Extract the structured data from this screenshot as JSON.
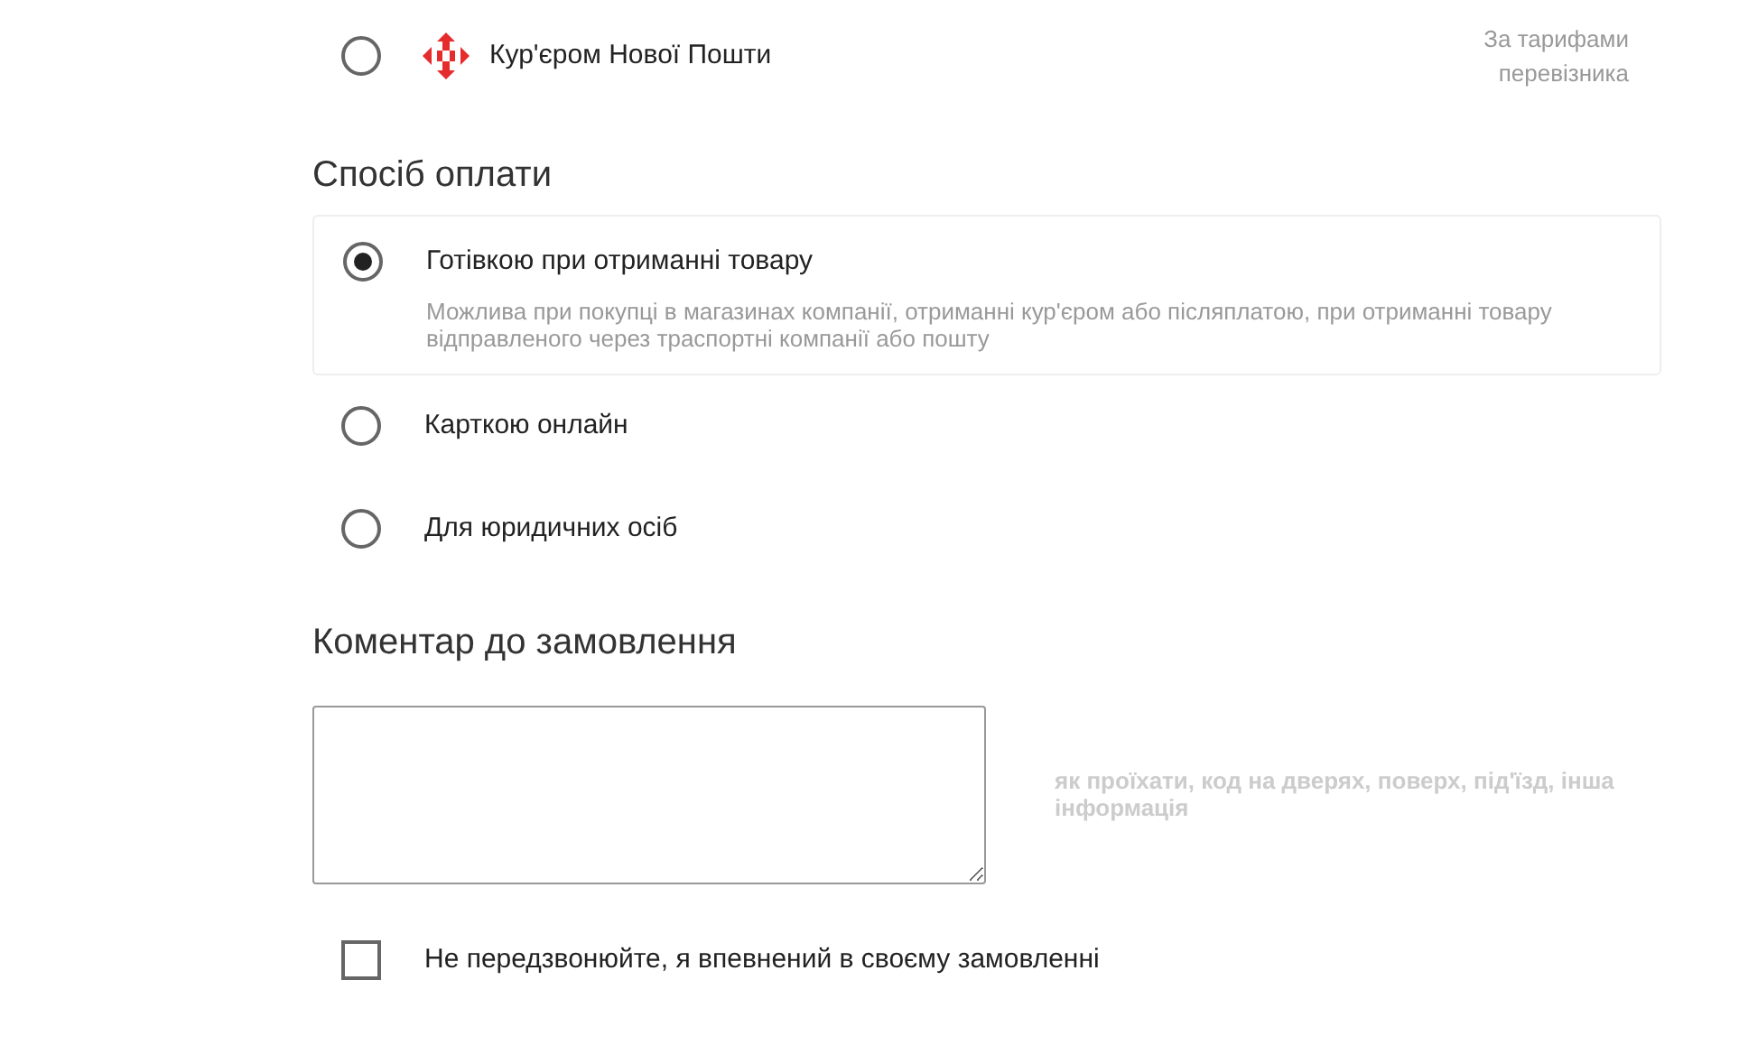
{
  "delivery": {
    "label": "Кур'єром Нової Пошти",
    "selected": false,
    "note": "За тарифами перевізника"
  },
  "payment": {
    "title": "Спосіб оплати",
    "options": [
      {
        "label": "Готівкою при отриманні товару",
        "description": "Можлива при покупці в магазинах компанії, отриманні кур'єром або післяплатою, при отриманні товару відправленого через траспортні компанії або пошту",
        "selected": true
      },
      {
        "label": "Карткою онлайн",
        "selected": false
      },
      {
        "label": "Для юридичних осіб",
        "selected": false
      }
    ]
  },
  "comment": {
    "title": "Коментар до замовлення",
    "hint": "як проїхати, код на дверях, поверх, під'їзд, інша інформація"
  },
  "no_call": {
    "label": "Не передзвонюйте, я впевнений в своєму замовленні",
    "checked": false
  }
}
